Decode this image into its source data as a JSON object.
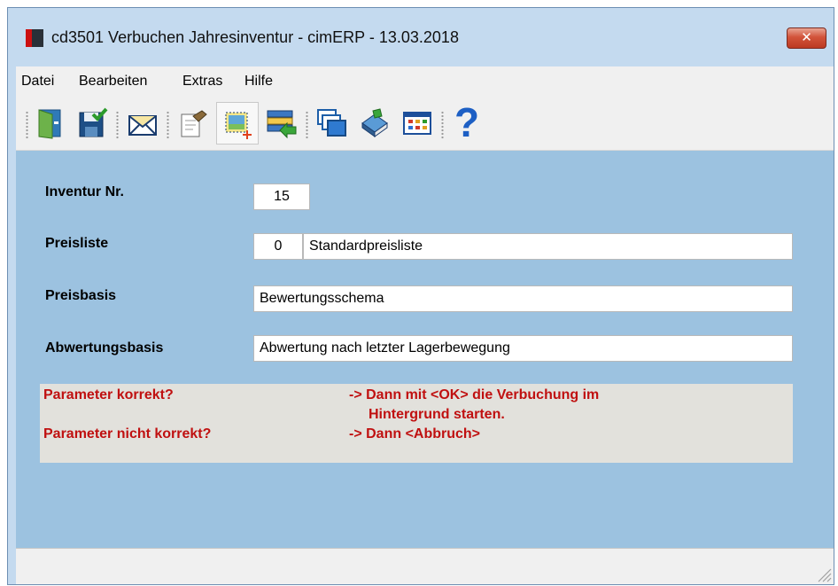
{
  "window": {
    "title": "cd3501 Verbuchen Jahresinventur - cimERP - 13.03.2018",
    "close_label": "✕"
  },
  "menu": [
    {
      "label": "Datei"
    },
    {
      "label": "Bearbeiten"
    },
    {
      "label": "Extras"
    },
    {
      "label": "Hilfe"
    }
  ],
  "toolbar": {
    "icons": [
      "exit-door-icon",
      "save-check-icon",
      "mail-envelope-icon",
      "edit-document-icon",
      "new-record-icon",
      "transfer-records-icon",
      "windows-icon",
      "book-icon",
      "table-grid-icon",
      "help-question-icon"
    ],
    "help_glyph": "?"
  },
  "form": {
    "inventur_nr": {
      "label": "Inventur Nr.",
      "value": "15"
    },
    "preisliste": {
      "label": "Preisliste",
      "number": "0",
      "name": "Standardpreisliste"
    },
    "preisbasis": {
      "label": "Preisbasis",
      "value": "Bewertungsschema"
    },
    "abwertungsbasis": {
      "label": "Abwertungsbasis",
      "value": "Abwertung nach letzter Lagerbewegung"
    }
  },
  "message": {
    "line1_left": "Parameter korrekt?",
    "line1_right": "-> Dann mit <OK> die Verbuchung im",
    "line2_right": "Hintergrund starten.",
    "line3_left": "Parameter nicht korrekt?",
    "line3_right": "-> Dann <Abbruch>"
  },
  "colors": {
    "content_bg": "#9cc2e0",
    "message_text": "#c01010",
    "message_bg": "#e2e1dc",
    "close_button": "#c8472d"
  }
}
